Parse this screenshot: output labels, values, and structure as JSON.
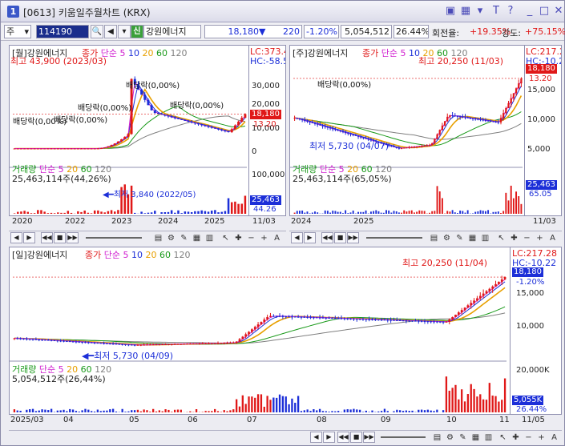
{
  "window": {
    "number": "1",
    "title": "[0613] 키움일주월차트 (KRX)",
    "controls": [
      "▣",
      "▦",
      "▾",
      "T",
      "?",
      "_",
      "□",
      "✕"
    ]
  },
  "toolbar": {
    "market": "주",
    "code": "114190",
    "credit_badge": "신",
    "stock_name": "강원에너지",
    "price": "18,180",
    "change_arrow": "▼",
    "change": "220",
    "change_pct": "-1.20%",
    "volume": "5,054,512",
    "turnover_pct": "26.44%",
    "turnover_label": "회전율:",
    "turnover_value": "+19.35%",
    "strength_label": "강도:",
    "strength_value": "+75.15%"
  },
  "monthly": {
    "title": "[월]강원에너지",
    "legend": [
      "종가",
      "단순",
      "5",
      "10",
      "20",
      "60",
      "120"
    ],
    "lc": "LC:373.4",
    "hc": "HC:-58.5",
    "y_ticks": [
      "30,000",
      "20,000",
      "10,000",
      "0"
    ],
    "price_tag": "18,180",
    "pct_tag": "13.20",
    "high": "최고 43,900 (2023/03)",
    "low": "최저 3,840 (2022/05)",
    "dividends": [
      "배당락(0,00%)",
      "배당락(0,00%)",
      "배당락(0,00%)",
      "배당락(0,00%)",
      "배당락(0,00%)",
      "배당락(0,00%)"
    ],
    "vol_title": "거래량  단순 5  20  60  120",
    "vol_value": "25,463,114주(44,26%)",
    "vol_ticks": [
      "100,000"
    ],
    "vol_tag": "25,463",
    "vol_pct": "44.26",
    "x_labels": [
      "2020",
      "2022",
      "2023",
      "2024",
      "2025",
      "11/03"
    ]
  },
  "weekly": {
    "title": "[주]강원에너지",
    "legend": [
      "종가",
      "단순",
      "5",
      "10",
      "20",
      "60",
      "120"
    ],
    "lc": "LC:217.2",
    "hc": "HC:-10.2",
    "y_ticks": [
      "15,000",
      "10,000",
      "5,000"
    ],
    "price_tag": "18,180",
    "pct_tag": "13.20",
    "high": "최고 20,250 (11/03)",
    "low": "최저 5,730 (04/07)",
    "dividend": "배당락(0,00%)",
    "vol_title": "거래량  단순 5  20  60  120",
    "vol_value": "25,463,114주(65,05%)",
    "vol_tag": "25,463",
    "vol_pct": "65.05",
    "x_labels": [
      "2024",
      "2025",
      "11/03"
    ]
  },
  "daily": {
    "title": "[일]강원에너지",
    "legend": [
      "종가",
      "단순",
      "5",
      "10",
      "20",
      "60",
      "120"
    ],
    "lc": "LC:217.28",
    "hc": "HC:-10.22",
    "y_ticks": [
      "15,000",
      "10,000"
    ],
    "price_tag": "18,180",
    "pct_tag": "-1.20%",
    "high": "최고 20,250 (11/04)",
    "low": "최저 5,730 (04/09)",
    "vol_title": "거래량  단순 5  20  60  120",
    "vol_value": "5,054,512주(26,44%)",
    "vol_ticks": [
      "20,000K"
    ],
    "vol_tag": "5,055K",
    "vol_pct": "26.44%",
    "x_labels": [
      "2025/03",
      "04",
      "05",
      "06",
      "07",
      "08",
      "09",
      "10",
      "11",
      "11/05"
    ]
  },
  "colors": {
    "up": "#e01818",
    "down": "#1c2fd8",
    "ma5": "#d020d0",
    "ma10": "#1c2fd8",
    "ma20": "#e8a000",
    "ma60": "#1a9a1a",
    "ma120": "#808080"
  }
}
